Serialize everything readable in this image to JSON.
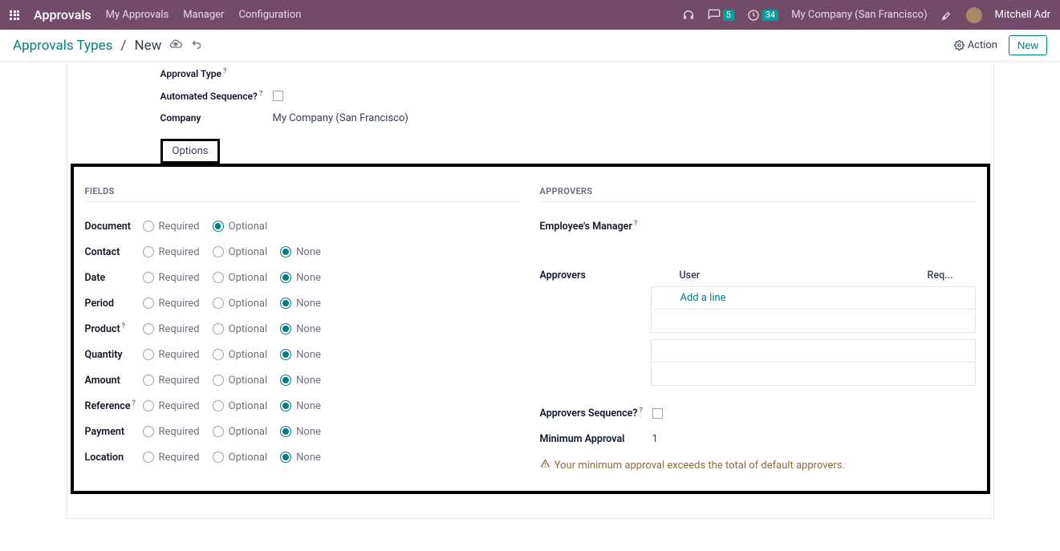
{
  "header": {
    "brand": "Approvals",
    "nav": [
      "My Approvals",
      "Manager",
      "Configuration"
    ],
    "badges": {
      "messages": "5",
      "activities": "34"
    },
    "company": "My Company (San Francisco)",
    "user": "Mitchell Adr"
  },
  "breadcrumbs": {
    "parent": "Approvals Types",
    "current": "New",
    "action": "Action",
    "new_btn": "New"
  },
  "upper": {
    "approval_type": "Approval Type",
    "automated_sequence": "Automated Sequence?",
    "company_label": "Company",
    "company_value": "My Company (San Francisco)"
  },
  "tab": {
    "options": "Options"
  },
  "radio_labels": {
    "required": "Required",
    "optional": "Optional",
    "none": "None"
  },
  "sections": {
    "fields": "FIELDS",
    "approvers": "APPROVERS"
  },
  "fields_rows": [
    {
      "label": "Document",
      "help": false,
      "opts": [
        "Required",
        "Optional"
      ],
      "selected": "Optional"
    },
    {
      "label": "Contact",
      "help": false,
      "opts": [
        "Required",
        "Optional",
        "None"
      ],
      "selected": "None"
    },
    {
      "label": "Date",
      "help": false,
      "opts": [
        "Required",
        "Optional",
        "None"
      ],
      "selected": "None"
    },
    {
      "label": "Period",
      "help": false,
      "opts": [
        "Required",
        "Optional",
        "None"
      ],
      "selected": "None"
    },
    {
      "label": "Product",
      "help": true,
      "opts": [
        "Required",
        "Optional",
        "None"
      ],
      "selected": "None"
    },
    {
      "label": "Quantity",
      "help": false,
      "opts": [
        "Required",
        "Optional",
        "None"
      ],
      "selected": "None"
    },
    {
      "label": "Amount",
      "help": false,
      "opts": [
        "Required",
        "Optional",
        "None"
      ],
      "selected": "None"
    },
    {
      "label": "Reference",
      "help": true,
      "opts": [
        "Required",
        "Optional",
        "None"
      ],
      "selected": "None"
    },
    {
      "label": "Payment",
      "help": false,
      "opts": [
        "Required",
        "Optional",
        "None"
      ],
      "selected": "None"
    },
    {
      "label": "Location",
      "help": false,
      "opts": [
        "Required",
        "Optional",
        "None"
      ],
      "selected": "None"
    }
  ],
  "approvers": {
    "employees_manager": "Employee's Manager",
    "approvers_label": "Approvers",
    "table_headers": {
      "user": "User",
      "req": "Req..."
    },
    "add_line": "Add a line",
    "sequence_label": "Approvers Sequence?",
    "min_approval_label": "Minimum Approval",
    "min_approval_value": "1",
    "warning": "Your minimum approval exceeds the total of default approvers."
  }
}
